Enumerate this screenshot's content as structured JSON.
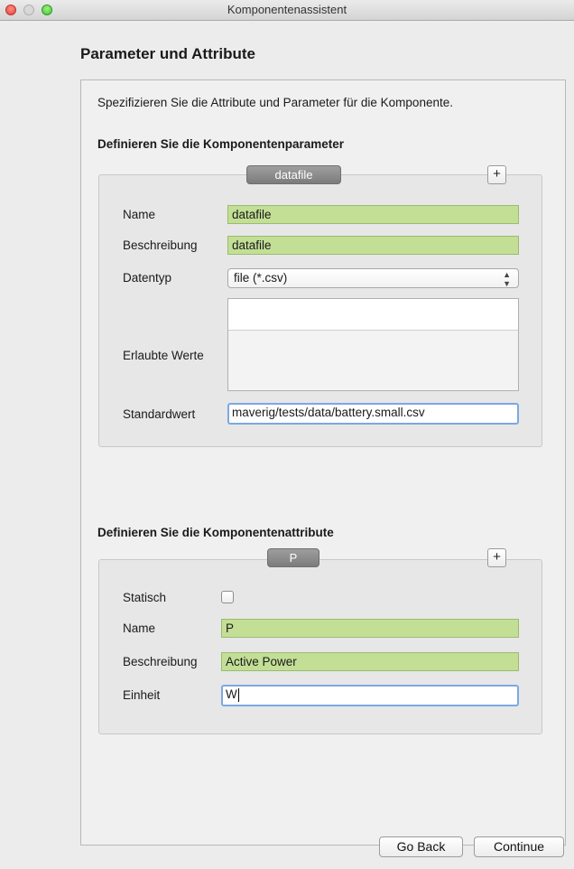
{
  "window": {
    "title": "Komponentenassistent"
  },
  "page": {
    "title": "Parameter und Attribute",
    "intro": "Spezifizieren Sie die Attribute und Parameter für die Komponente."
  },
  "parameters": {
    "section_title": "Definieren Sie die Komponentenparameter",
    "tab": "datafile",
    "add_label": "+",
    "name_label": "Name",
    "name_value": "datafile",
    "description_label": "Beschreibung",
    "description_value": "datafile",
    "datatype_label": "Datentyp",
    "datatype_value": "file (*.csv)",
    "allowed_values_label": "Erlaubte Werte",
    "default_label": "Standardwert",
    "default_value": "maverig/tests/data/battery.small.csv"
  },
  "attributes": {
    "section_title": "Definieren Sie die Komponentenattribute",
    "tab": "P",
    "add_label": "+",
    "static_label": "Statisch",
    "static_checked": false,
    "name_label": "Name",
    "name_value": "P",
    "description_label": "Beschreibung",
    "description_value": "Active Power",
    "unit_label": "Einheit",
    "unit_value": "W"
  },
  "footer": {
    "back_label": "Go Back",
    "continue_label": "Continue"
  },
  "colors": {
    "valid_field": "#c3df96",
    "focus_ring": "#7aa9e2",
    "tab": "#8c8c8c"
  }
}
